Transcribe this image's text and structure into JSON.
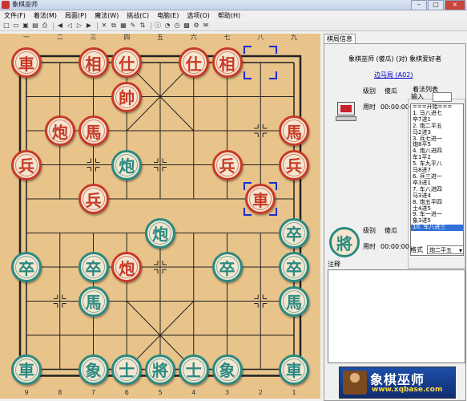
{
  "window": {
    "title": "象棋巫师",
    "buttons": [
      "–",
      "□",
      "×"
    ]
  },
  "menu": [
    "文件(F)",
    "着法(M)",
    "局面(P)",
    "魔法(W)",
    "挑战(C)",
    "电脑(E)",
    "选项(O)",
    "帮助(H)"
  ],
  "toolbar_icons": [
    "new-icon",
    "open-icon",
    "save-icon",
    "saveas-icon",
    "print-icon",
    "first-move-icon",
    "prev-move-icon",
    "next-move-icon",
    "last-move-icon",
    "delete-icon",
    "copy-icon",
    "paste-icon",
    "edit-icon",
    "flip-icon",
    "info-icon",
    "think-icon",
    "clock-icon",
    "engine-icon",
    "settings-icon",
    "chat-icon"
  ],
  "board": {
    "top_numbers": [
      "一",
      "二",
      "三",
      "四",
      "五",
      "六",
      "七",
      "八",
      "九"
    ],
    "bottom_numbers": [
      "9",
      "8",
      "7",
      "6",
      "5",
      "4",
      "3",
      "2",
      "1"
    ],
    "pieces": [
      {
        "ch": "車",
        "side": "red",
        "c": 0,
        "r": 0
      },
      {
        "ch": "相",
        "side": "red",
        "c": 2,
        "r": 0
      },
      {
        "ch": "仕",
        "side": "red",
        "c": 3,
        "r": 0
      },
      {
        "ch": "仕",
        "side": "red",
        "c": 5,
        "r": 0
      },
      {
        "ch": "相",
        "side": "red",
        "c": 6,
        "r": 0
      },
      {
        "ch": "帥",
        "side": "red",
        "c": 3,
        "r": 1
      },
      {
        "ch": "炮",
        "side": "red",
        "c": 1,
        "r": 2
      },
      {
        "ch": "馬",
        "side": "red",
        "c": 2,
        "r": 2
      },
      {
        "ch": "馬",
        "side": "red",
        "c": 8,
        "r": 2
      },
      {
        "ch": "兵",
        "side": "red",
        "c": 0,
        "r": 3
      },
      {
        "ch": "炮",
        "side": "black",
        "c": 3,
        "r": 3
      },
      {
        "ch": "兵",
        "side": "red",
        "c": 6,
        "r": 3
      },
      {
        "ch": "兵",
        "side": "red",
        "c": 8,
        "r": 3
      },
      {
        "ch": "兵",
        "side": "red",
        "c": 2,
        "r": 4
      },
      {
        "ch": "車",
        "side": "red",
        "c": 7,
        "r": 4
      },
      {
        "ch": "炮",
        "side": "black",
        "c": 4,
        "r": 5
      },
      {
        "ch": "卒",
        "side": "black",
        "c": 8,
        "r": 5
      },
      {
        "ch": "卒",
        "side": "black",
        "c": 0,
        "r": 6
      },
      {
        "ch": "卒",
        "side": "black",
        "c": 2,
        "r": 6
      },
      {
        "ch": "炮",
        "side": "red",
        "c": 3,
        "r": 6
      },
      {
        "ch": "卒",
        "side": "black",
        "c": 6,
        "r": 6
      },
      {
        "ch": "卒",
        "side": "black",
        "c": 8,
        "r": 6
      },
      {
        "ch": "馬",
        "side": "black",
        "c": 2,
        "r": 7
      },
      {
        "ch": "馬",
        "side": "black",
        "c": 8,
        "r": 7
      },
      {
        "ch": "車",
        "side": "black",
        "c": 0,
        "r": 9
      },
      {
        "ch": "象",
        "side": "black",
        "c": 2,
        "r": 9
      },
      {
        "ch": "士",
        "side": "black",
        "c": 3,
        "r": 9
      },
      {
        "ch": "將",
        "side": "black",
        "c": 4,
        "r": 9
      },
      {
        "ch": "士",
        "side": "black",
        "c": 5,
        "r": 9
      },
      {
        "ch": "象",
        "side": "black",
        "c": 6,
        "r": 9
      },
      {
        "ch": "車",
        "side": "black",
        "c": 8,
        "r": 9
      }
    ],
    "selections": [
      {
        "c": 7,
        "r": 0
      },
      {
        "c": 7,
        "r": 4
      }
    ]
  },
  "panel": {
    "tab": "棋局信息",
    "match": "象棋巫师 (傻瓜)   (对)   象棋爱好者",
    "opening": "边马局 (A02)",
    "red": {
      "level_label": "级别",
      "level": "傻瓜",
      "time_label": "用时",
      "time": "00:00:00"
    },
    "black": {
      "level_label": "级别",
      "level": "傻瓜",
      "time_label": "用时",
      "time": "00:00:00",
      "piece": "將"
    },
    "moves_title": "着法列表",
    "input_label": "输入",
    "moves": [
      "===开始===",
      "1. 马八进七",
      "   卒7进1",
      "2. 炮二平五",
      "   马2进3",
      "3. 兵七进一",
      "   炮8平5",
      "4. 炮八进四",
      "   车1平2",
      "5. 车九平八",
      "   马8进7",
      "6. 兵三进一",
      "   卒3进1",
      "7. 车八进四",
      "   马3进4",
      "8. 炮五平四",
      "   士4进5",
      "9. 车一进一",
      "   象3进5",
      "10. 车八进三"
    ],
    "selected_move": 19,
    "format_label": "格式",
    "format_value": "炮二平五",
    "notes_label": "注释",
    "banner_cn": "象棋巫师",
    "banner_url": "www.xqbase.com"
  }
}
